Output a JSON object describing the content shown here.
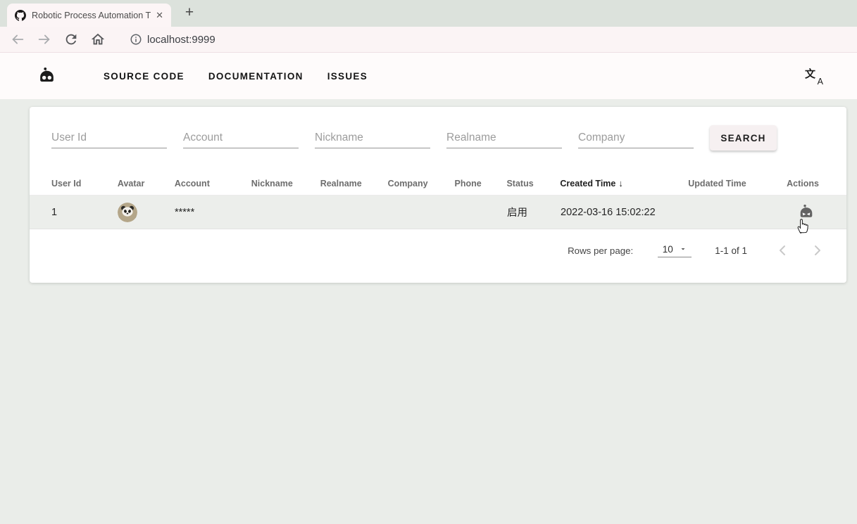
{
  "browser": {
    "tab": {
      "title": "Robotic Process Automation T",
      "close_glyph": "✕"
    },
    "new_tab_glyph": "+",
    "url": "localhost:9999"
  },
  "navbar": {
    "links": [
      {
        "label": "SOURCE CODE"
      },
      {
        "label": "DOCUMENTATION"
      },
      {
        "label": "ISSUES"
      }
    ],
    "translate_icon": {
      "cjk": "文",
      "latin": "A"
    }
  },
  "search": {
    "fields": [
      {
        "placeholder": "User Id"
      },
      {
        "placeholder": "Account"
      },
      {
        "placeholder": "Nickname"
      },
      {
        "placeholder": "Realname"
      },
      {
        "placeholder": "Company"
      }
    ],
    "button_label": "SEARCH"
  },
  "table": {
    "headers": [
      {
        "label": "User Id"
      },
      {
        "label": "Avatar"
      },
      {
        "label": "Account"
      },
      {
        "label": "Nickname"
      },
      {
        "label": "Realname"
      },
      {
        "label": "Company"
      },
      {
        "label": "Phone"
      },
      {
        "label": "Status"
      },
      {
        "label": "Created Time",
        "sort": "desc",
        "sort_icon": "↓"
      },
      {
        "label": "Updated Time"
      },
      {
        "label": "Actions"
      }
    ],
    "rows": [
      {
        "user_id": "1",
        "avatar_icon": "panda-avatar",
        "account": "*****",
        "nickname": "",
        "realname": "",
        "company": "",
        "phone": "",
        "status": "启用",
        "created_time": "2022-03-16 15:02:22",
        "updated_time": "",
        "action_icon": "robot-icon"
      }
    ]
  },
  "pagination": {
    "rows_per_page_label": "Rows per page:",
    "rows_per_page_value": "10",
    "range_label": "1-1 of 1"
  },
  "colors": {
    "tabstrip_bg": "#dce2dc",
    "toolbar_bg": "#fbf4f5",
    "navbar_bg": "#fefbfb",
    "page_bg": "#eaede9",
    "card_bg": "#ffffff",
    "row_hover_bg": "#eceeeb",
    "text_dark": "#212121",
    "text_gray": "#6d6d6d",
    "disabled_gray": "#c9c9c9"
  }
}
